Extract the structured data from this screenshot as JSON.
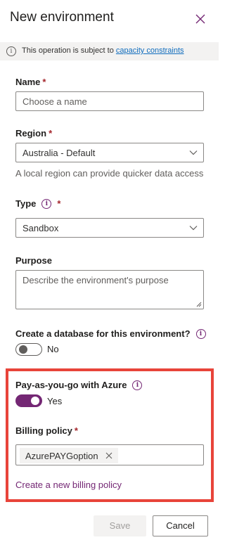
{
  "panel": {
    "title": "New environment"
  },
  "notice": {
    "text": "This operation is subject to",
    "link": "capacity constraints"
  },
  "name_field": {
    "label": "Name",
    "required_mark": "*",
    "placeholder": "Choose a name",
    "value": ""
  },
  "region_field": {
    "label": "Region",
    "required_mark": "*",
    "value": "Australia - Default",
    "helper": "A local region can provide quicker data access"
  },
  "type_field": {
    "label": "Type",
    "required_mark": "*",
    "value": "Sandbox"
  },
  "purpose_field": {
    "label": "Purpose",
    "placeholder": "Describe the environment's purpose",
    "value": ""
  },
  "database_toggle": {
    "label": "Create a database for this environment?",
    "state_text": "No",
    "on": false
  },
  "azure_toggle": {
    "label": "Pay-as-you-go with Azure",
    "state_text": "Yes",
    "on": true
  },
  "billing_policy": {
    "label": "Billing policy",
    "required_mark": "*",
    "selected": "AzurePAYGoption",
    "create_link": "Create a new billing policy"
  },
  "footer": {
    "save_label": "Save",
    "cancel_label": "Cancel"
  },
  "colors": {
    "accent": "#742774",
    "highlight_border": "#e8443a",
    "link_blue": "#0f6cbd",
    "required": "#a4262c"
  },
  "icons": [
    "close-icon",
    "info-icon",
    "chevron-down-icon",
    "remove-icon"
  ]
}
